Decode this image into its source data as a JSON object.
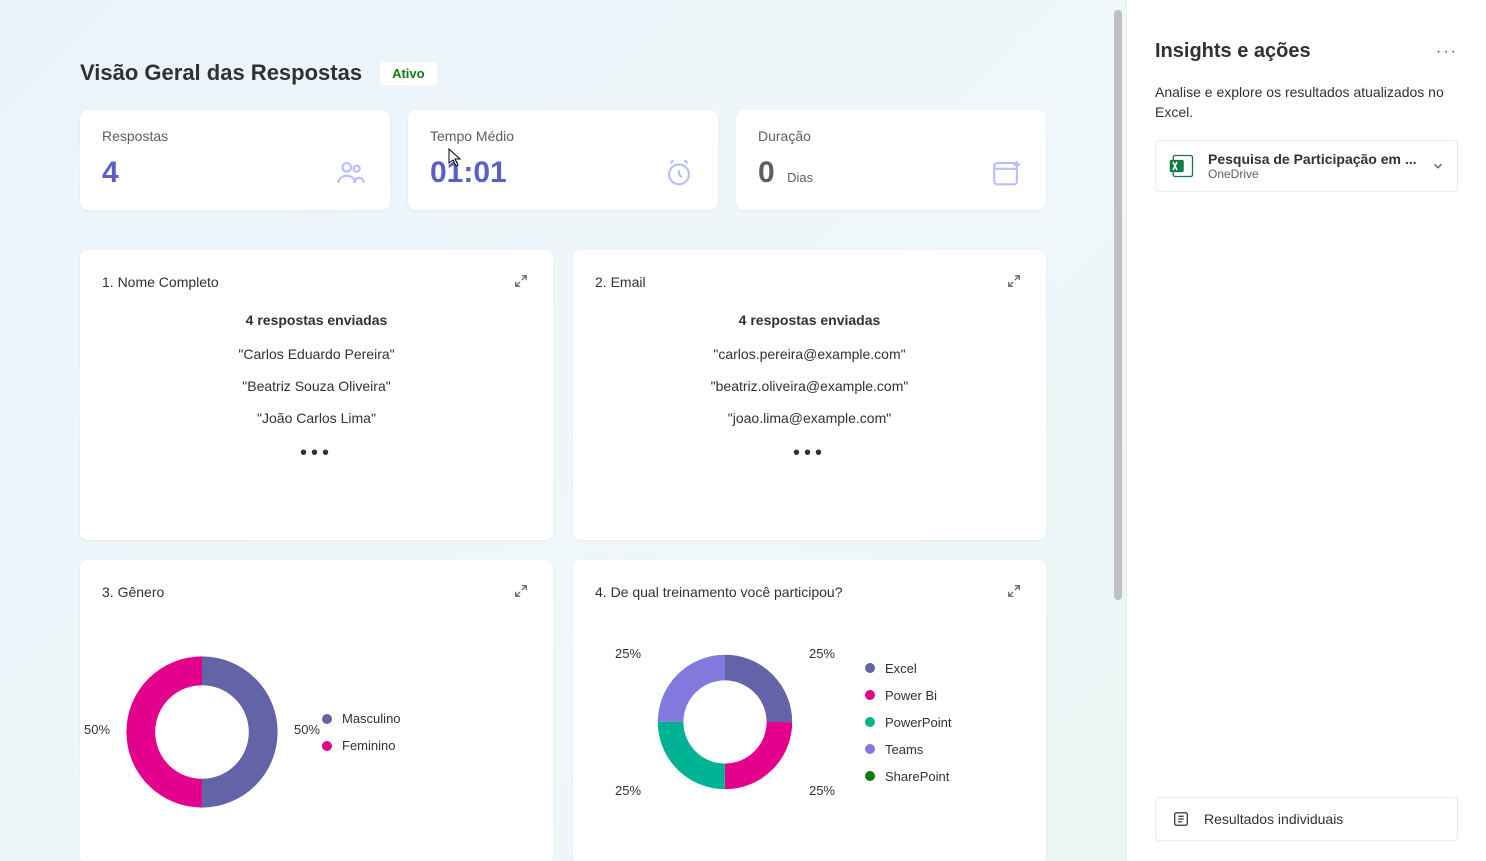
{
  "header": {
    "title": "Visão Geral das Respostas",
    "status": "Ativo"
  },
  "stats": {
    "responses": {
      "label": "Respostas",
      "value": "4"
    },
    "avg_time": {
      "label": "Tempo Médio",
      "value": "01:01"
    },
    "duration": {
      "label": "Duração",
      "value": "0",
      "unit": "Dias"
    }
  },
  "questions": {
    "q1": {
      "title": "1. Nome Completo",
      "summary": "4 respostas enviadas",
      "items": [
        "\"Carlos Eduardo Pereira\"",
        "\"Beatriz Souza Oliveira\"",
        "\"João Carlos Lima\""
      ]
    },
    "q2": {
      "title": "2. Email",
      "summary": "4 respostas enviadas",
      "items": [
        "\"carlos.pereira@example.com\"",
        "\"beatriz.oliveira@example.com\"",
        "\"joao.lima@example.com\""
      ]
    },
    "q3": {
      "title": "3. Gênero"
    },
    "q4": {
      "title": "4. De qual treinamento você participou?"
    }
  },
  "chart_data": [
    {
      "type": "pie",
      "title": "Gênero",
      "series": [
        {
          "name": "Masculino",
          "value": 50,
          "color": "#6264a7"
        },
        {
          "name": "Feminino",
          "value": 50,
          "color": "#e3008c"
        }
      ],
      "labels": {
        "left": "50%",
        "right": "50%"
      }
    },
    {
      "type": "pie",
      "title": "De qual treinamento você participou?",
      "series": [
        {
          "name": "Excel",
          "value": 25,
          "color": "#6264a7"
        },
        {
          "name": "Power Bi",
          "value": 25,
          "color": "#e3008c"
        },
        {
          "name": "PowerPoint",
          "value": 25,
          "color": "#00b294"
        },
        {
          "name": "Teams",
          "value": 25,
          "color": "#8378de"
        },
        {
          "name": "SharePoint",
          "value": 0,
          "color": "#107c10"
        }
      ],
      "labels": {
        "tl": "25%",
        "tr": "25%",
        "bl": "25%",
        "br": "25%"
      }
    }
  ],
  "side": {
    "title": "Insights e ações",
    "desc": "Analise e explore os resultados atualizados no Excel.",
    "file": {
      "name": "Pesquisa de Participação em ...",
      "location": "OneDrive"
    },
    "individual": "Resultados individuais"
  }
}
